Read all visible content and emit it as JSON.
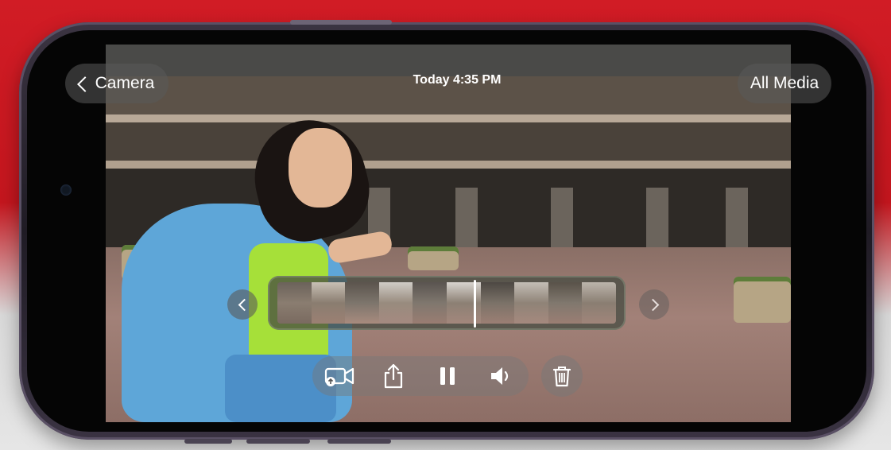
{
  "nav": {
    "back_label": "Camera",
    "title": "Today 4:35 PM",
    "all_media_label": "All Media"
  },
  "controls": {
    "icons": [
      "camera-upload-icon",
      "share-icon",
      "pause-icon",
      "volume-icon",
      "trash-icon"
    ]
  },
  "scrubber": {
    "prev_icon": "chevron-left-icon",
    "next_icon": "chevron-right-icon",
    "thumbnail_count": 10
  },
  "colors": {
    "background_red": "#d11c25",
    "phone_frame": "#2b2531",
    "ui_pill": "#5a5a5a",
    "text": "#ffffff"
  }
}
